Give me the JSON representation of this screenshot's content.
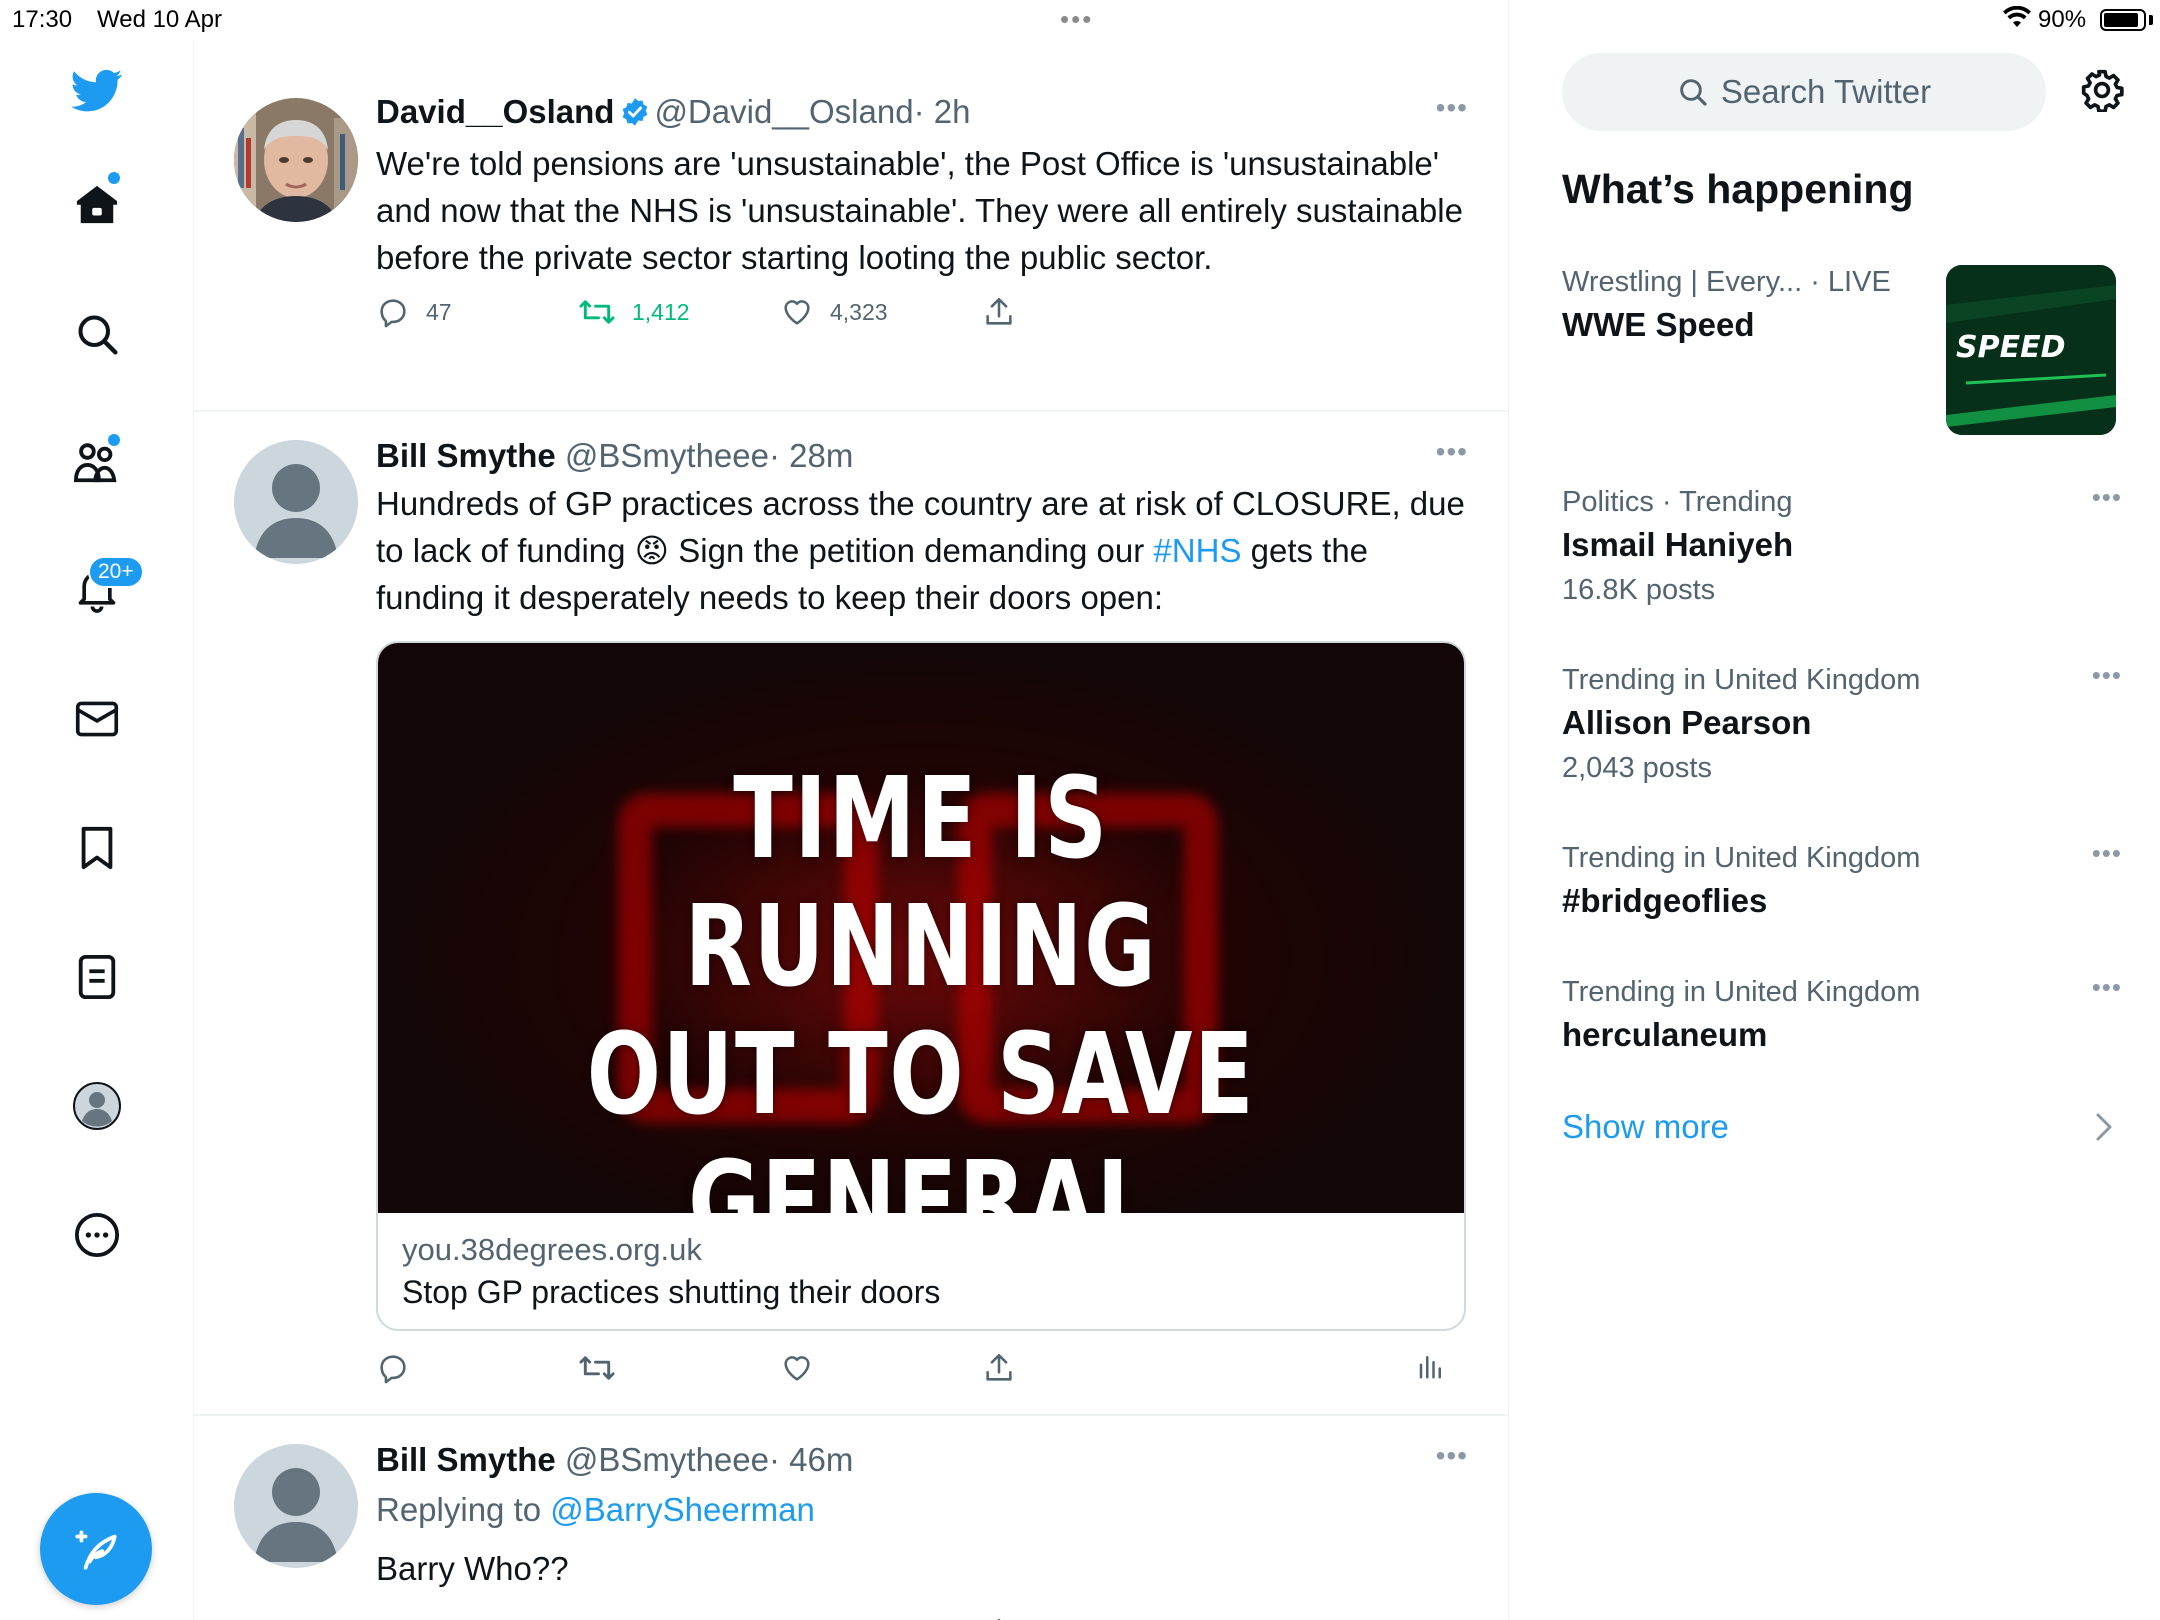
{
  "status_bar": {
    "time": "17:30",
    "date": "Wed 10 Apr",
    "battery": "90%",
    "battery_level": 0.9
  },
  "nav": {
    "notifications_badge": "20+",
    "items": [
      "home",
      "explore",
      "communities",
      "notifications",
      "messages",
      "bookmarks",
      "lists",
      "profile",
      "more"
    ]
  },
  "tweets": [
    {
      "name": "David__Osland",
      "verified": true,
      "handle": "@David__Osland",
      "time": "· 2h",
      "text": "We're told pensions are 'unsustainable', the Post Office is 'unsustainable' and now that the NHS is 'unsustainable'. They were all entirely sustainable before the private sector starting looting the public sector.",
      "replies": "47",
      "retweets": "1,412",
      "likes": "4,323"
    },
    {
      "name": "Bill Smythe",
      "handle": "@BSmytheee",
      "time": "· 28m",
      "text_before": "Hundreds of GP practices across the country are at risk of CLOSURE, due to lack of funding",
      "emoji": "😡",
      "text_mid": " Sign the petition demanding our ",
      "hashtag": "#NHS",
      "text_after": " gets the funding it desperately needs to keep their doors open:",
      "card": {
        "headline_1": "TIME IS RUNNING",
        "headline_2": "OUT TO SAVE",
        "headline_3": "GENERAL PRACTICE",
        "domain": "you.38degrees.org.uk",
        "title": "Stop GP practices shutting their doors"
      }
    },
    {
      "name": "Bill Smythe",
      "handle": "@BSmytheee",
      "time": "· 46m",
      "replying_to_label": "Replying to ",
      "replying_to": "@BarrySheerman",
      "text": "Barry Who??"
    }
  ],
  "sidebar": {
    "search_placeholder": "Search Twitter",
    "section_title": "What’s happening",
    "trends": [
      {
        "context": "Wrestling | Every...",
        "live": "· LIVE",
        "name": "WWE Speed",
        "thumb_text": "SPEED"
      },
      {
        "context": "Politics · Trending",
        "name": "Ismail Haniyeh",
        "count": "16.8K posts"
      },
      {
        "context": "Trending in United Kingdom",
        "name": "Allison Pearson",
        "count": "2,043 posts"
      },
      {
        "context": "Trending in United Kingdom",
        "name": "#bridgeoflies"
      },
      {
        "context": "Trending in United Kingdom",
        "name": "herculaneum"
      }
    ],
    "show_more": "Show more"
  },
  "colors": {
    "accent": "#1d9bf0",
    "retweet_green": "#00ba7c",
    "muted": "#536471",
    "border": "#eff3f4"
  }
}
